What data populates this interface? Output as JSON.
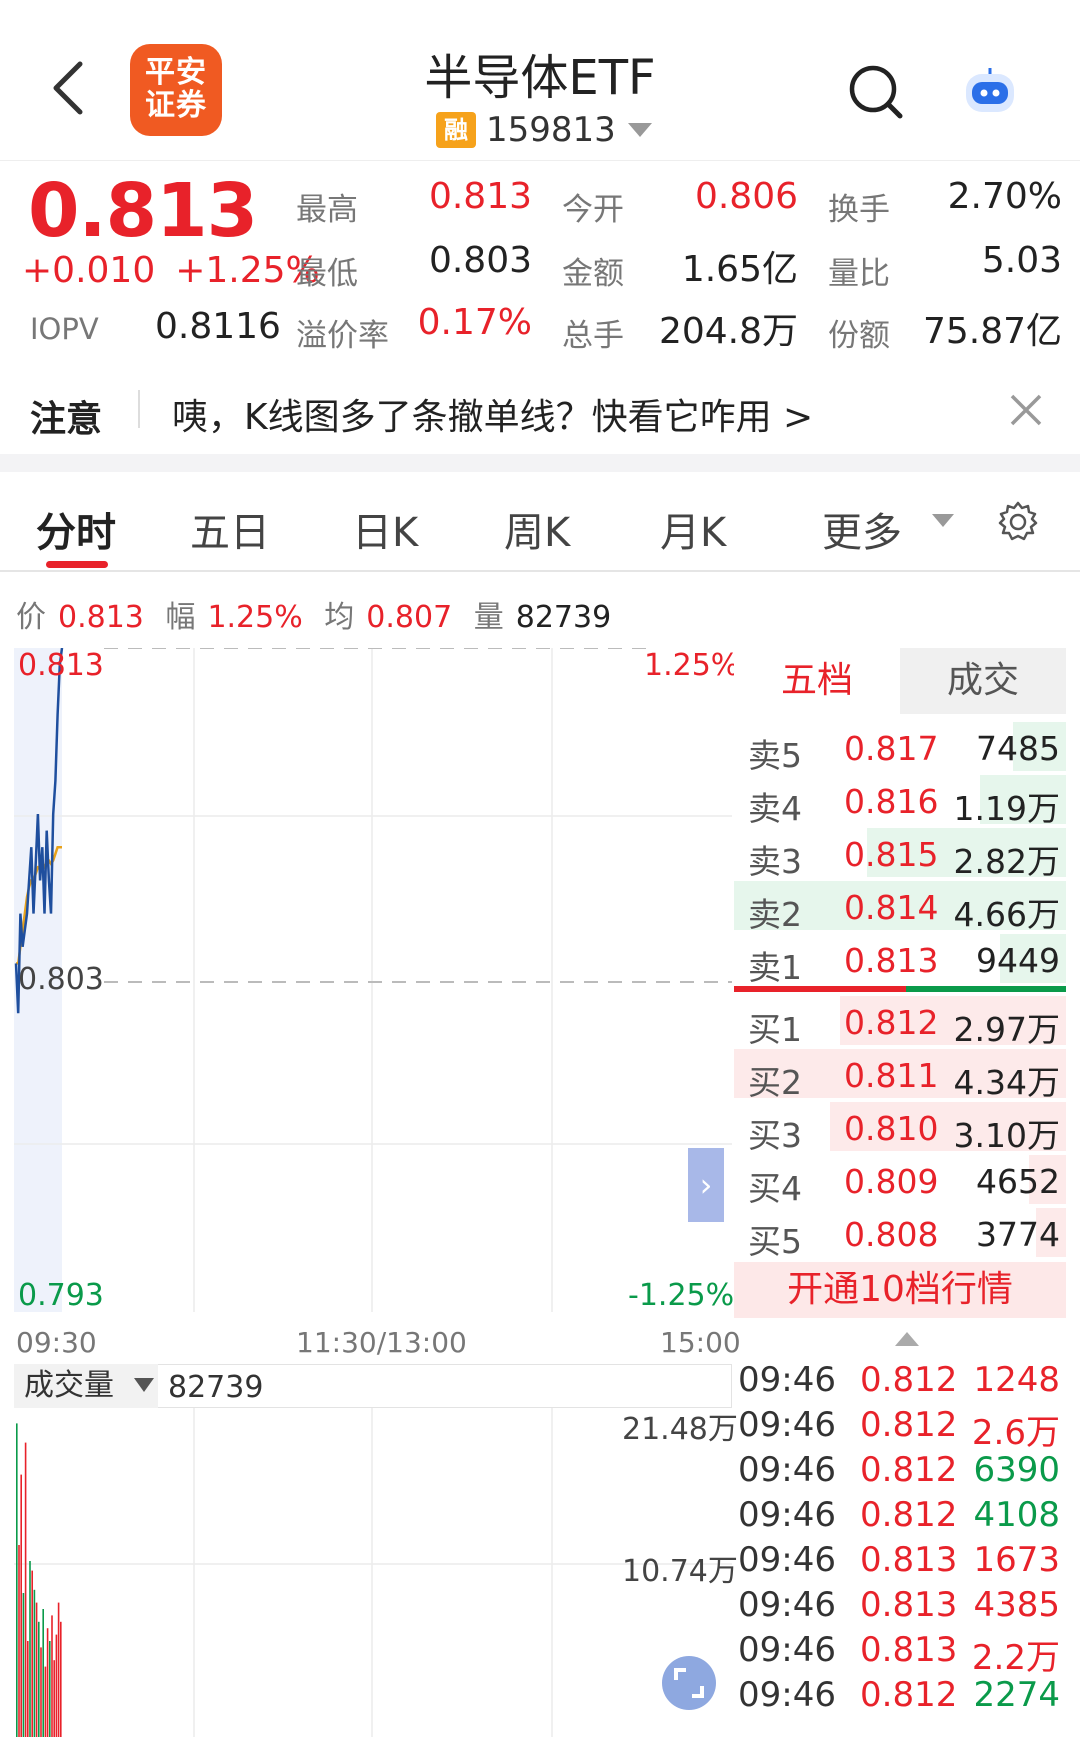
{
  "header": {
    "title": "半导体ETF",
    "margin_badge": "融",
    "code": "159813",
    "logo_line1": "平安",
    "logo_line2": "证券"
  },
  "quote": {
    "price": "0.813",
    "change": "+0.010",
    "change_pct": "+1.25%",
    "iopv_label": "IOPV",
    "iopv_value": "0.8116",
    "stats": [
      {
        "label": "最高",
        "value": "0.813",
        "color": "#e8222a"
      },
      {
        "label": "今开",
        "value": "0.806",
        "color": "#e8222a"
      },
      {
        "label": "换手",
        "value": "2.70%",
        "color": "#222222"
      },
      {
        "label": "最低",
        "value": "0.803",
        "color": "#222222"
      },
      {
        "label": "金额",
        "value": "1.65亿",
        "color": "#222222"
      },
      {
        "label": "量比",
        "value": "5.03",
        "color": "#222222"
      },
      {
        "label": "溢价率",
        "value": "0.17%",
        "color": "#e8222a"
      },
      {
        "label": "总手",
        "value": "204.8万",
        "color": "#222222"
      },
      {
        "label": "份额",
        "value": "75.87亿",
        "color": "#222222"
      }
    ]
  },
  "notice": {
    "tag": "注意",
    "text": "咦，K线图多了条撤单线？快看它咋用 >"
  },
  "tabs": [
    "分时",
    "五日",
    "日K",
    "周K",
    "月K",
    "更多"
  ],
  "info_line": {
    "price_label": "价",
    "price": "0.813",
    "amp_label": "幅",
    "amp": "1.25%",
    "avg_label": "均",
    "avg": "0.807",
    "vol_label": "量",
    "vol": "82739"
  },
  "chart_data": {
    "type": "line",
    "title": "",
    "y_labels": {
      "top": "0.813",
      "mid": "0.803",
      "bottom": "0.793",
      "top_pct": "1.25%",
      "bottom_pct": "-1.25%"
    },
    "ylim": [
      0.793,
      0.813
    ],
    "x_labels": [
      "09:30",
      "11:30/13:00",
      "15:00"
    ],
    "series": [
      {
        "values": [
          0.8035,
          0.802,
          0.805,
          0.804,
          0.8045,
          0.805,
          0.806,
          0.807,
          0.805,
          0.8065,
          0.808,
          0.806,
          0.807,
          0.805,
          0.8075,
          0.806,
          0.805,
          0.808,
          0.809,
          0.811,
          0.8125,
          0.813
        ]
      },
      {
        "values": [
          0.8035,
          0.8035,
          0.804,
          0.8045,
          0.805,
          0.8055,
          0.8058,
          0.806,
          0.806,
          0.8062,
          0.8064,
          0.8064,
          0.8065,
          0.8064,
          0.8066,
          0.8066,
          0.8065,
          0.8066,
          0.8068,
          0.807,
          0.807,
          0.807
        ]
      }
    ],
    "colors": {
      "price": "#1f4f9e",
      "avg": "#e8a21b"
    }
  },
  "orderbook": {
    "tab_active": "五档",
    "tab_other": "成交",
    "sell": [
      {
        "label": "卖5",
        "price": "0.817",
        "vol": "7485",
        "fill": 0.16
      },
      {
        "label": "卖4",
        "price": "0.816",
        "vol": "1.19万",
        "fill": 0.26
      },
      {
        "label": "卖3",
        "price": "0.815",
        "vol": "2.82万",
        "fill": 0.6
      },
      {
        "label": "卖2",
        "price": "0.814",
        "vol": "4.66万",
        "fill": 1.0
      },
      {
        "label": "卖1",
        "price": "0.813",
        "vol": "9449",
        "fill": 0.2
      }
    ],
    "buy": [
      {
        "label": "买1",
        "price": "0.812",
        "vol": "2.97万",
        "fill": 0.68
      },
      {
        "label": "买2",
        "price": "0.811",
        "vol": "4.34万",
        "fill": 1.0
      },
      {
        "label": "买3",
        "price": "0.810",
        "vol": "3.10万",
        "fill": 0.71
      },
      {
        "label": "买4",
        "price": "0.809",
        "vol": "4652",
        "fill": 0.11
      },
      {
        "label": "买5",
        "price": "0.808",
        "vol": "3774",
        "fill": 0.09
      }
    ],
    "open_more": "开通10档行情"
  },
  "volume": {
    "selector": "成交量",
    "value": "82739",
    "y_top": "21.48万",
    "y_mid": "10.74万",
    "bars": [
      {
        "v": 0.98,
        "c": "#0a9a4a"
      },
      {
        "v": 0.6,
        "c": "#e8222a"
      },
      {
        "v": 0.82,
        "c": "#e8222a"
      },
      {
        "v": 0.45,
        "c": "#0a9a4a"
      },
      {
        "v": 0.92,
        "c": "#e8222a"
      },
      {
        "v": 0.3,
        "c": "#e8222a"
      },
      {
        "v": 0.55,
        "c": "#0a9a4a"
      },
      {
        "v": 0.52,
        "c": "#e8222a"
      },
      {
        "v": 0.46,
        "c": "#0a9a4a"
      },
      {
        "v": 0.42,
        "c": "#e8222a"
      },
      {
        "v": 0.36,
        "c": "#0a9a4a"
      },
      {
        "v": 0.28,
        "c": "#e8222a"
      },
      {
        "v": 0.4,
        "c": "#0a9a4a"
      },
      {
        "v": 0.22,
        "c": "#e8222a"
      },
      {
        "v": 0.34,
        "c": "#e8222a"
      },
      {
        "v": 0.3,
        "c": "#0a9a4a"
      },
      {
        "v": 0.38,
        "c": "#e8222a"
      },
      {
        "v": 0.24,
        "c": "#e8222a"
      },
      {
        "v": 0.32,
        "c": "#e8222a"
      },
      {
        "v": 0.42,
        "c": "#e8222a"
      },
      {
        "v": 0.36,
        "c": "#e8222a"
      }
    ]
  },
  "ticks": [
    {
      "time": "09:46",
      "price": "0.812",
      "vol": "1248",
      "color": "#e8222a"
    },
    {
      "time": "09:46",
      "price": "0.812",
      "vol": "2.6万",
      "color": "#e8222a"
    },
    {
      "time": "09:46",
      "price": "0.812",
      "vol": "6390",
      "color": "#0a9a4a"
    },
    {
      "time": "09:46",
      "price": "0.812",
      "vol": "4108",
      "color": "#0a9a4a"
    },
    {
      "time": "09:46",
      "price": "0.813",
      "vol": "1673",
      "color": "#e8222a"
    },
    {
      "time": "09:46",
      "price": "0.813",
      "vol": "4385",
      "color": "#e8222a"
    },
    {
      "time": "09:46",
      "price": "0.813",
      "vol": "2.2万",
      "color": "#e8222a"
    },
    {
      "time": "09:46",
      "price": "0.812",
      "vol": "2274",
      "color": "#0a9a4a"
    }
  ]
}
